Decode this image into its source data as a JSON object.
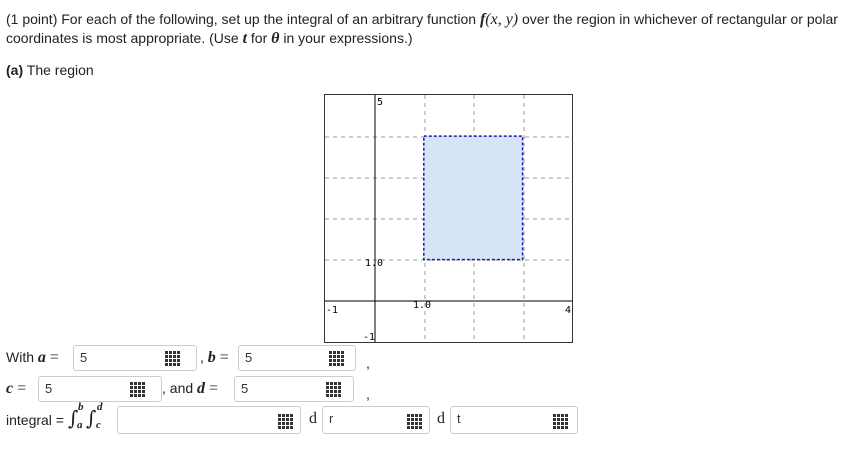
{
  "problem": {
    "text_before_f": "(1 point) For each of the following, set up the integral of an arbitrary function ",
    "f": "f",
    "f_args": "(x, y)",
    "text_after_f": " over the region in whichever of rectangular or polar coordinates is most appropriate. (Use ",
    "t_var": "t",
    "text_for": " for ",
    "theta": "θ",
    "text_end": " in your expressions.)"
  },
  "part_a": {
    "label": "(a)",
    "title": " The region"
  },
  "graph": {
    "x_range": [
      -1,
      4
    ],
    "y_range": [
      -1,
      5
    ],
    "tick_labels": {
      "top_y": "5",
      "y_one": "1.0",
      "x_one": "1.0",
      "x_min": "-1",
      "x_max": "4",
      "y_min": "-1"
    },
    "region": {
      "x1": 1,
      "x2": 3,
      "y1": 1,
      "y2": 4,
      "fill": "#d6e4f5",
      "stroke": "#1a1ab0"
    }
  },
  "inputs": {
    "with_label": "With ",
    "a_var": "a",
    "eq": " = ",
    "a_value": "5",
    "comma_b": " , ",
    "b_var": "b",
    "b_value": "5",
    "trailing_comma_1": ",",
    "c_var": "c",
    "c_value": "5",
    "and_text": " , and ",
    "d_var": "d",
    "d_value": "5",
    "trailing_comma_2": ",",
    "integral_label": "integral = ",
    "int_lower_1": "a",
    "int_upper_1": "b",
    "int_lower_2": "c",
    "int_upper_2": "d",
    "integrand_value": "",
    "d1": "d",
    "var1": "r",
    "d2": "d",
    "var2": "t"
  }
}
